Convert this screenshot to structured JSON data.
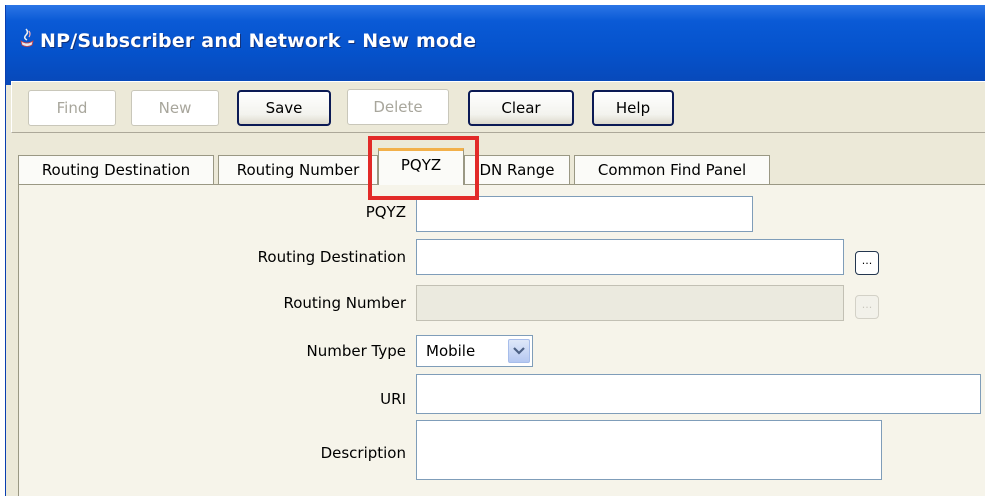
{
  "window": {
    "title": "NP/Subscriber and Network  -  New mode",
    "icon": "java-cup-icon"
  },
  "toolbar": {
    "buttons": [
      {
        "label": "Find",
        "enabled": false
      },
      {
        "label": "New",
        "enabled": false
      },
      {
        "label": "Save",
        "enabled": true
      },
      {
        "label": "Delete",
        "enabled": false
      },
      {
        "label": "Clear",
        "enabled": true
      },
      {
        "label": "Help",
        "enabled": true
      }
    ]
  },
  "tabs": [
    {
      "label": "Routing Destination",
      "active": false
    },
    {
      "label": "Routing Number",
      "active": false
    },
    {
      "label": "PQYZ",
      "active": true
    },
    {
      "label": "DN Range",
      "active": false
    },
    {
      "label": "Common Find Panel",
      "active": false
    }
  ],
  "form": {
    "pqyz": {
      "label": "PQYZ",
      "value": ""
    },
    "routing_destination": {
      "label": "Routing Destination",
      "value": "",
      "browse": "..."
    },
    "routing_number": {
      "label": "Routing Number",
      "value": "",
      "browse": "..."
    },
    "number_type": {
      "label": "Number Type",
      "value": "Mobile"
    },
    "uri": {
      "label": "URI",
      "value": ""
    },
    "description": {
      "label": "Description",
      "value": ""
    }
  },
  "colors": {
    "titlebar": "#0552cb",
    "highlight": "#e22a28",
    "active_tab_accent": "#f2b04a"
  }
}
